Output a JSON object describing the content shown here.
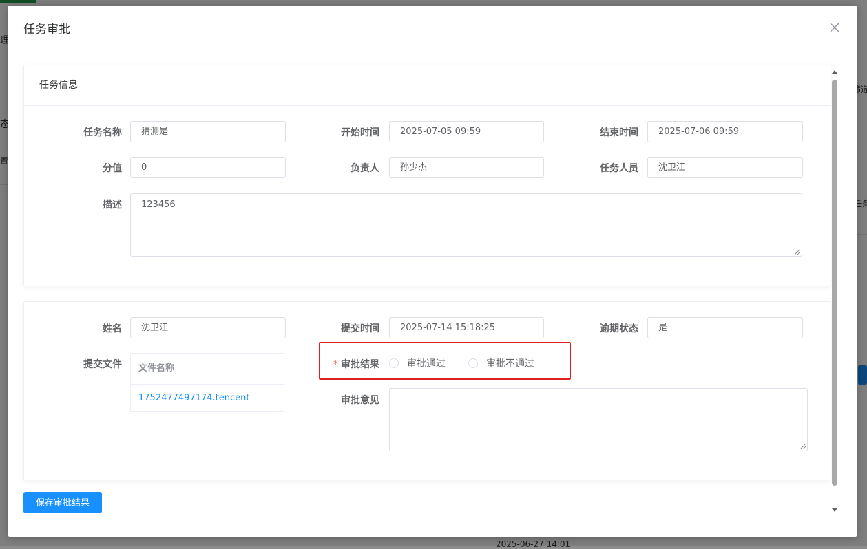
{
  "background": {
    "frag_li": "理",
    "frag_tai": "态",
    "frag_zhi": "置",
    "frag_shaixuan": "筛选",
    "frag_renwu": "任务",
    "frag_date": "2025-06-27 14:01"
  },
  "dialog": {
    "title": "任务审批",
    "close_icon": "close-icon"
  },
  "task_info": {
    "header": "任务信息",
    "name_label": "任务名称",
    "name_value": "猜测是",
    "start_label": "开始时间",
    "start_value": "2025-07-05 09:59",
    "end_label": "结束时间",
    "end_value": "2025-07-06 09:59",
    "score_label": "分值",
    "score_value": "0",
    "owner_label": "负责人",
    "owner_value": "孙少杰",
    "member_label": "任务人员",
    "member_value": "沈卫江",
    "desc_label": "描述",
    "desc_value": "123456"
  },
  "submission": {
    "name_label": "姓名",
    "name_value": "沈卫江",
    "submit_time_label": "提交时间",
    "submit_time_value": "2025-07-14 15:18:25",
    "overdue_label": "逾期状态",
    "overdue_value": "是",
    "files_label": "提交文件",
    "files_header": "文件名称",
    "files": [
      "1752477497174.tencent"
    ]
  },
  "approval": {
    "required_mark": "*",
    "result_label": "审批结果",
    "options": [
      "审批通过",
      "审批不通过"
    ],
    "opinion_label": "审批意见",
    "opinion_value": ""
  },
  "actions": {
    "save_label": "保存审批结果"
  },
  "colors": {
    "primary": "#1890ff",
    "highlight": "#e02020",
    "required": "#f56c6c"
  }
}
